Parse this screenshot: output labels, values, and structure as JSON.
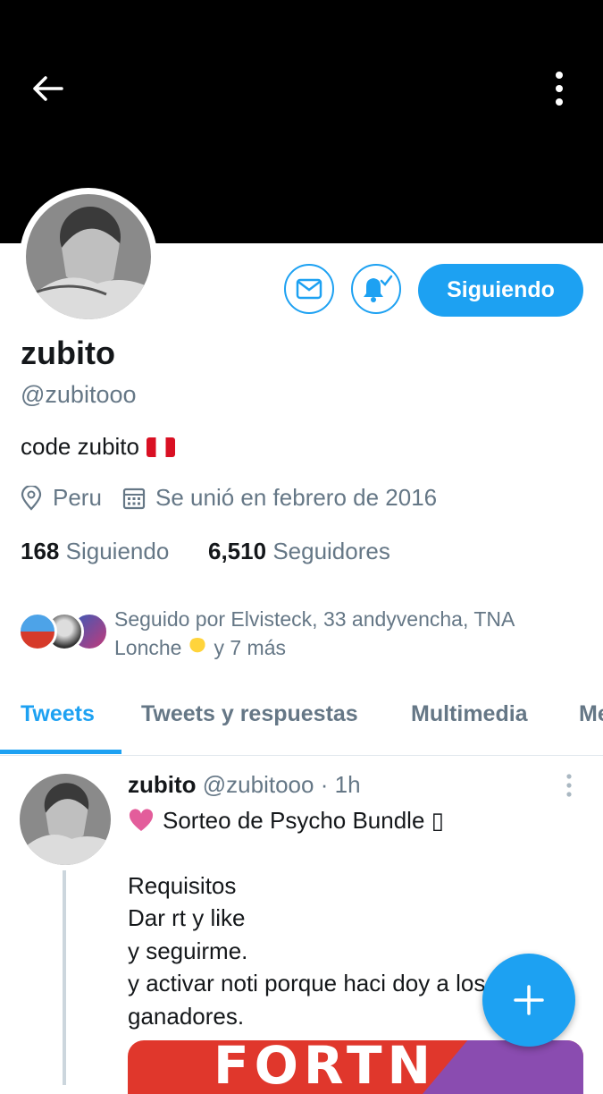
{
  "header": {
    "back_icon": "arrow-left-icon",
    "more_icon": "vertical-dots-icon"
  },
  "profile": {
    "name": "zubito",
    "handle": "@zubitooo",
    "bio": "code zubito",
    "bio_flag": "peru-flag",
    "location": "Peru",
    "joined": "Se unió en febrero de 2016",
    "following_count": "168",
    "following_label": "Siguiendo",
    "followers_count": "6,510",
    "followers_label": "Seguidores"
  },
  "actions": {
    "message_icon": "envelope-icon",
    "notify_icon": "bell-check-icon",
    "follow_label": "Siguiendo"
  },
  "followed_by": {
    "text": "Seguido por Elvisteck, 33 andyvencha, TNA Lonche",
    "suffix": "y 7 más"
  },
  "tabs": [
    "Tweets",
    "Tweets y respuestas",
    "Multimedia",
    "Me"
  ],
  "active_tab": "Tweets",
  "tweet": {
    "name": "zubito",
    "handle": "@zubitooo",
    "dot": "·",
    "time": "1h",
    "line1": "Sorteo de Psycho Bundle",
    "line1_tail": "▯",
    "body": "Requisitos\nDar rt y like\ny seguirme.\ny activar noti porque haci doy a los\nganadores.",
    "media_text": "FORTN"
  },
  "fab_icon": "plus-icon",
  "colors": {
    "accent": "#1da1f2",
    "muted": "#657786",
    "heart": "#e0245e"
  }
}
